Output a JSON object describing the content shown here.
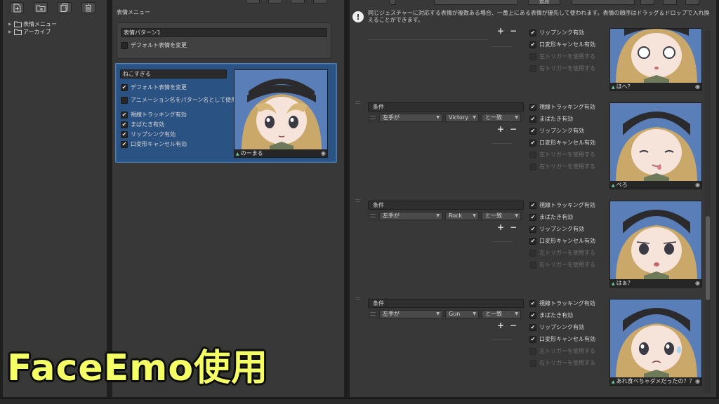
{
  "colors": {
    "panel": "#383838",
    "selection": "#2f5b8e",
    "overlay_text": "#f4ff66"
  },
  "left_toolbar": {
    "buttons": [
      {
        "icon": "add-file-icon"
      },
      {
        "icon": "add-folder-icon"
      },
      {
        "icon": "copy-icon"
      },
      {
        "icon": "trash-icon"
      }
    ]
  },
  "tree": {
    "items": [
      {
        "label": "表情メニュー",
        "icon": "folder-icon"
      },
      {
        "label": "アーカイブ",
        "icon": "folder-icon"
      }
    ]
  },
  "mid": {
    "title": "表情メニュー",
    "mode_box": {
      "name": "表情パターン1",
      "change_default_label": "デフォルト表情を変更",
      "change_default_checked": false
    },
    "pattern": {
      "name": "ねこすぎる",
      "options": [
        {
          "label": "デフォルト表情を変更",
          "checked": true
        },
        {
          "label": "アニメーション名をパターン名として使用",
          "checked": false
        },
        {
          "label": "視線トラッキング有効",
          "checked": true
        },
        {
          "label": "まばたき有効",
          "checked": true
        },
        {
          "label": "リップシンク有効",
          "checked": true
        },
        {
          "label": "口変形キャンセル有効",
          "checked": true
        }
      ],
      "thumb_label": "のーまる"
    }
  },
  "right": {
    "top_button": "追加",
    "notice": "同じジェスチャーに対応する表情が複数ある場合、一番上にある表情が優先して使われます。表情の順序はドラッグ＆ドロップで入れ換えることができます。",
    "first_card": {
      "options": [
        {
          "label": "リップシンク有効",
          "checked": true,
          "disabled": false
        },
        {
          "label": "口変形キャンセル有効",
          "checked": true,
          "disabled": false
        },
        {
          "label": "左トリガーを使用する",
          "checked": false,
          "disabled": true
        },
        {
          "label": "右トリガーを使用する",
          "checked": false,
          "disabled": true
        }
      ],
      "thumb_label": "ほへ？"
    },
    "cards": [
      {
        "condition_title": "条件",
        "hand": "左手が",
        "gesture": "Victory",
        "match": "と一致",
        "thumb_label": "べろ",
        "options": [
          {
            "label": "視線トラッキング有効",
            "checked": true,
            "disabled": false
          },
          {
            "label": "まばたき有効",
            "checked": true,
            "disabled": false
          },
          {
            "label": "リップシンク有効",
            "checked": true,
            "disabled": false
          },
          {
            "label": "口変形キャンセル有効",
            "checked": true,
            "disabled": false
          },
          {
            "label": "左トリガーを使用する",
            "checked": false,
            "disabled": true
          },
          {
            "label": "右トリガーを使用する",
            "checked": false,
            "disabled": true
          }
        ]
      },
      {
        "condition_title": "条件",
        "hand": "左手が",
        "gesture": "Rock",
        "match": "と一致",
        "thumb_label": "はぁ？",
        "options": [
          {
            "label": "視線トラッキング有効",
            "checked": true,
            "disabled": false
          },
          {
            "label": "まばたき有効",
            "checked": true,
            "disabled": false
          },
          {
            "label": "リップシンク有効",
            "checked": true,
            "disabled": false
          },
          {
            "label": "口変形キャンセル有効",
            "checked": true,
            "disabled": false
          },
          {
            "label": "左トリガーを使用する",
            "checked": false,
            "disabled": true
          },
          {
            "label": "右トリガーを使用する",
            "checked": false,
            "disabled": true
          }
        ]
      },
      {
        "condition_title": "条件",
        "hand": "左手が",
        "gesture": "Gun",
        "match": "と一致",
        "thumb_label": "あれ食べちゃダメだったの？？",
        "options": [
          {
            "label": "視線トラッキング有効",
            "checked": true,
            "disabled": false
          },
          {
            "label": "まばたき有効",
            "checked": true,
            "disabled": false
          },
          {
            "label": "リップシンク有効",
            "checked": true,
            "disabled": false
          },
          {
            "label": "口変形キャンセル有効",
            "checked": true,
            "disabled": false
          },
          {
            "label": "左トリガーを使用する",
            "checked": false,
            "disabled": true
          },
          {
            "label": "右トリガーを使用する",
            "checked": false,
            "disabled": true
          }
        ]
      }
    ]
  },
  "overlay": {
    "text": "FaceEmo使用"
  }
}
